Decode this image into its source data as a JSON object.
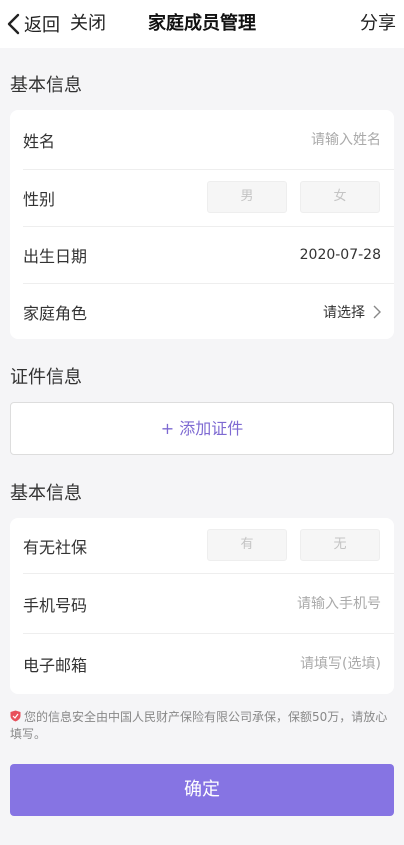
{
  "nav": {
    "back_label": "返回",
    "close_label": "关闭",
    "title": "家庭成员管理",
    "share_label": "分享"
  },
  "basic_info": {
    "title": "基本信息",
    "name": {
      "label": "姓名",
      "placeholder": "请输入姓名"
    },
    "gender": {
      "label": "性别",
      "male": "男",
      "female": "女"
    },
    "birth": {
      "label": "出生日期",
      "value": "2020-07-28"
    },
    "role": {
      "label": "家庭角色",
      "value": "请选择"
    }
  },
  "cert_info": {
    "title": "证件信息",
    "add_label": "+ 添加证件"
  },
  "extra_info": {
    "title": "基本信息",
    "social": {
      "label": "有无社保",
      "yes": "有",
      "no": "无"
    },
    "phone": {
      "label": "手机号码",
      "placeholder": "请输入手机号"
    },
    "email": {
      "label": "电子邮箱",
      "placeholder": "请填写(选填)"
    }
  },
  "notice": "您的信息安全由中国人民财产保险有限公司承保，保额50万，请放心填写。",
  "confirm_label": "确定",
  "colors": {
    "accent": "#8674e3",
    "link": "#7e6ad2",
    "shield": "#e8505b"
  }
}
